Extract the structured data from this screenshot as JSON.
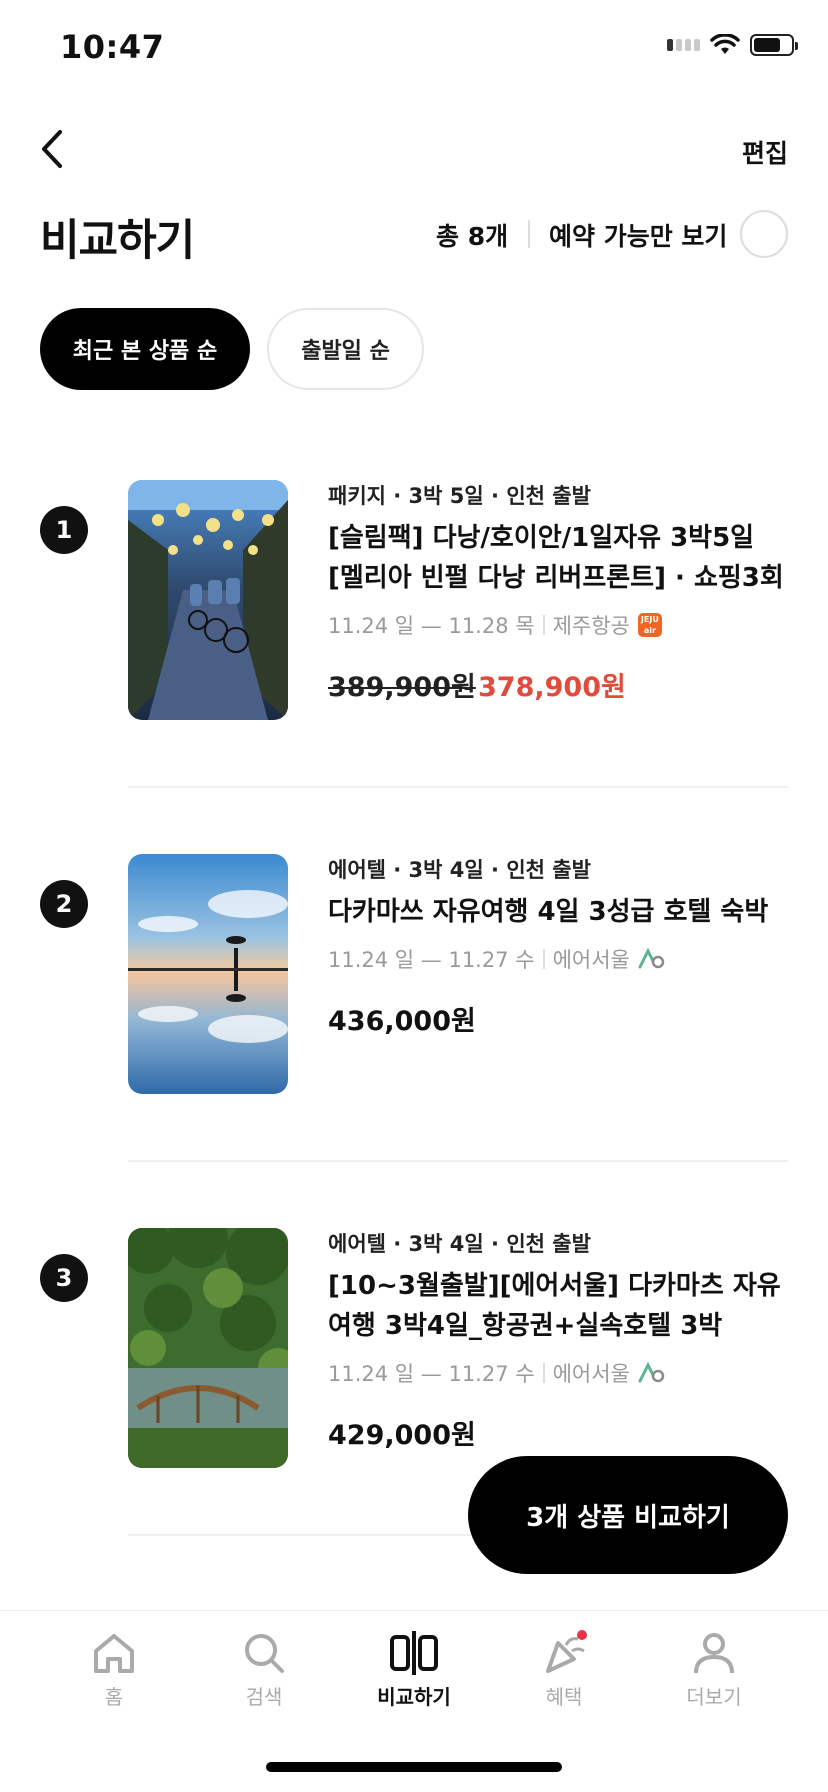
{
  "status_bar": {
    "time": "10:47"
  },
  "header": {
    "edit_label": "편집",
    "title": "비교하기",
    "total_count": "총 8개",
    "available_only_label": "예약 가능만 보기"
  },
  "sort": {
    "recent": "최근 본 상품 순",
    "departure": "출발일 순"
  },
  "items": [
    {
      "number": "1",
      "meta": "패키지 · 3박  5일 · 인천 출발",
      "title": "[슬림팩] 다낭/호이안/1일자유 3박5일 [멜리아 빈펄 다낭 리버프론트]  · 쇼핑3회",
      "dates": "11.24 일 — 11.28 목",
      "airline": "제주항공",
      "airline_logo_text": "JEJU air",
      "original_price": "389,900원",
      "price": "378,900원"
    },
    {
      "number": "2",
      "meta": "에어텔 · 3박  4일 · 인천 출발",
      "title": "다카마쓰 자유여행 4일 3성급 호텔 숙박",
      "dates": "11.24 일 — 11.27 수",
      "airline": "에어서울",
      "price": "436,000원"
    },
    {
      "number": "3",
      "meta": "에어텔 · 3박  4일 · 인천 출발",
      "title": "[10~3월출발][에어서울] 다카마츠 자유여행 3박4일_항공권+실속호텔 3박",
      "dates": "11.24 일 — 11.27 수",
      "airline": "에어서울",
      "price": "429,000원"
    }
  ],
  "compare_button": "3개 상품 비교하기",
  "tabbar": {
    "home": "홈",
    "search": "검색",
    "compare": "비교하기",
    "benefits": "혜택",
    "more": "더보기"
  },
  "colors": {
    "sale_price": "#e04b3c",
    "active_chip": "#000000",
    "notification_dot": "#e8334a",
    "jeju_air": "#f16522",
    "air_seoul": "#5bb58e"
  }
}
